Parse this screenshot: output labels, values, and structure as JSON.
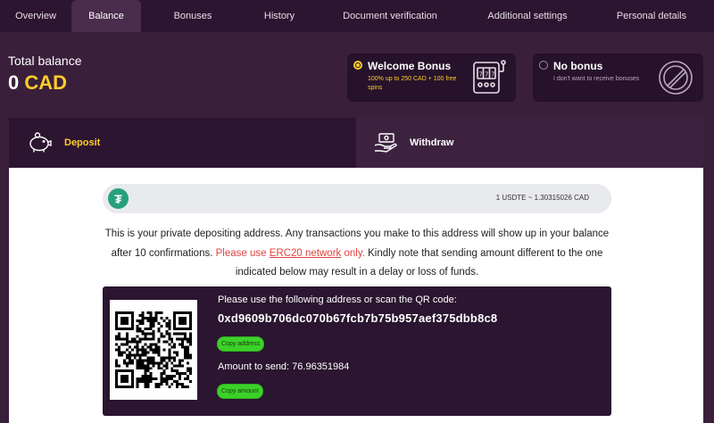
{
  "tabs": [
    {
      "label": "Overview"
    },
    {
      "label": "Balance"
    },
    {
      "label": "Bonuses"
    },
    {
      "label": "History"
    },
    {
      "label": "Document verification"
    },
    {
      "label": "Additional settings"
    },
    {
      "label": "Personal details"
    }
  ],
  "active_tab": "Balance",
  "balance": {
    "label": "Total balance",
    "amount": "0",
    "currency": "CAD"
  },
  "bonuses": {
    "welcome": {
      "title": "Welcome Bonus",
      "description": "100% up to 250 CAD + 100 free spins",
      "selected": true,
      "icon": "slot-machine-icon"
    },
    "none": {
      "title": "No bonus",
      "description": "I don't want to receive bonuses",
      "selected": false,
      "icon": "prohibited-icon"
    }
  },
  "panel": {
    "deposit_label": "Deposit",
    "withdraw_label": "Withdraw"
  },
  "currency": {
    "icon": "tether-icon",
    "symbol": "₮",
    "rate": "1 USDTE ~ 1.30315026 CAD"
  },
  "info": {
    "text1": "This is your private depositing address. Any transactions you make to this address will show up in your balance after 10 confirmations.",
    "warn_prefix": "Please use",
    "network": "ERC20 network",
    "warn_suffix": "only.",
    "text2": "Kindly note that sending amount different to the one indicated below may result in a delay or loss of funds."
  },
  "address": {
    "label": "Please use the following address or scan the QR code:",
    "value": "0xd9609b706dc070b67fcb7b75b957aef375dbb8c8",
    "copy_address_label": "Copy address",
    "amount_text": "Amount to send: 76.96351984",
    "copy_amount_label": "Copy amount"
  },
  "colors": {
    "accent": "#ffcc2a",
    "background": "#3a1f3b",
    "warning": "#e0443e",
    "button": "#3cd12a",
    "tether": "#26a17b"
  }
}
